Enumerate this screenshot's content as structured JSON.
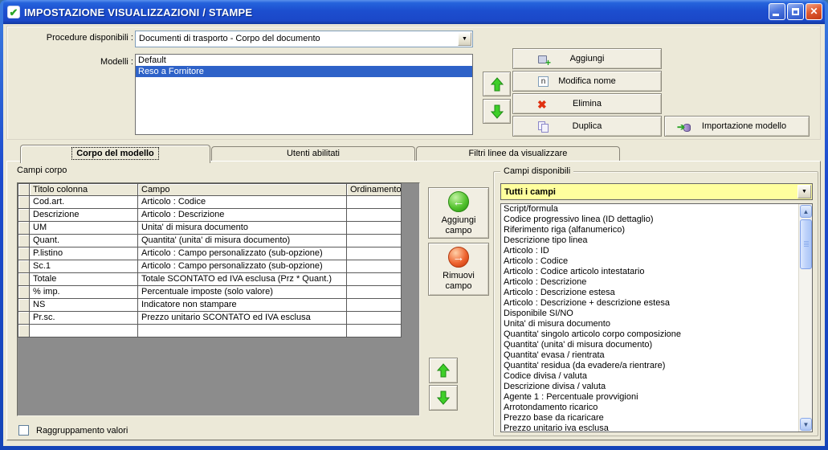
{
  "window": {
    "title": "IMPOSTAZIONE VISUALIZZAZIONI / STAMPE"
  },
  "colors": {
    "titlebar": "#1C4ACD",
    "selection": "#2E62C8",
    "filter_bg": "#FFFF9E",
    "arrow_green": "#3ECF28",
    "arrow_remove": "#EE6430",
    "grid_empty_area": "#8C8C8C",
    "window_bg": "#ECE9D8"
  },
  "top": {
    "procedure_label": "Procedure disponibili :",
    "procedure_value": "Documenti di trasporto - Corpo del documento",
    "modelli_label": "Modelli :",
    "modelli_items": [
      {
        "label": "Default",
        "selected": false
      },
      {
        "label": "Reso a Fornitore",
        "selected": true
      }
    ],
    "buttons": {
      "aggiungi": "Aggiungi",
      "modifica_nome": "Modifica nome",
      "elimina": "Elimina",
      "duplica": "Duplica",
      "importazione": "Importazione modello"
    }
  },
  "tabs": [
    {
      "label": "Corpo del modello",
      "active": true
    },
    {
      "label": "Utenti abilitati",
      "active": false
    },
    {
      "label": "Filtri linee da visualizzare",
      "active": false
    }
  ],
  "body_tab": {
    "campi_corpo_label": "Campi corpo",
    "grid": {
      "headers": [
        "Titolo colonna",
        "Campo",
        "Ordinamento"
      ],
      "rows": [
        {
          "titolo": "Cod.art.",
          "campo": "Articolo : Codice",
          "ordinamento": ""
        },
        {
          "titolo": "Descrizione",
          "campo": "Articolo : Descrizione",
          "ordinamento": ""
        },
        {
          "titolo": "UM",
          "campo": "Unita' di misura documento",
          "ordinamento": ""
        },
        {
          "titolo": "Quant.",
          "campo": "Quantita' (unita' di misura documento)",
          "ordinamento": ""
        },
        {
          "titolo": "P.listino",
          "campo": "Articolo : Campo personalizzato (sub-opzione)",
          "ordinamento": ""
        },
        {
          "titolo": "Sc.1",
          "campo": "Articolo : Campo personalizzato (sub-opzione)",
          "ordinamento": ""
        },
        {
          "titolo": "Totale",
          "campo": "Totale SCONTATO ed IVA esclusa (Prz * Quant.)",
          "ordinamento": ""
        },
        {
          "titolo": "% imp.",
          "campo": "Percentuale imposte (solo valore)",
          "ordinamento": ""
        },
        {
          "titolo": "NS",
          "campo": "Indicatore non stampare",
          "ordinamento": ""
        },
        {
          "titolo": "Pr.sc.",
          "campo": "Prezzo unitario SCONTATO ed IVA esclusa",
          "ordinamento": ""
        }
      ]
    },
    "aggiungi_campo": "Aggiungi campo",
    "rimuovi_campo": "Rimuovi campo",
    "campi_disponibili": {
      "label": "Campi disponibili",
      "filter_value": "Tutti i campi",
      "items": [
        "Script/formula",
        "Codice progressivo linea (ID dettaglio)",
        "Riferimento riga (alfanumerico)",
        "Descrizione tipo linea",
        "Articolo : ID",
        "Articolo : Codice",
        "Articolo : Codice articolo intestatario",
        "Articolo : Descrizione",
        "Articolo : Descrizione estesa",
        "Articolo : Descrizione + descrizione estesa",
        "Disponibile SI/NO",
        "Unita' di misura documento",
        "Quantita' singolo articolo corpo composizione",
        "Quantita' (unita' di misura documento)",
        "Quantita' evasa / rientrata",
        "Quantita' residua (da evadere/a rientrare)",
        "Codice divisa / valuta",
        "Descrizione divisa / valuta",
        "Agente 1 : Percentuale provvigioni",
        "Arrotondamento ricarico",
        "Prezzo base da ricaricare",
        "Prezzo unitario iva esclusa"
      ]
    },
    "raggruppamento_label": "Raggruppamento valori"
  }
}
